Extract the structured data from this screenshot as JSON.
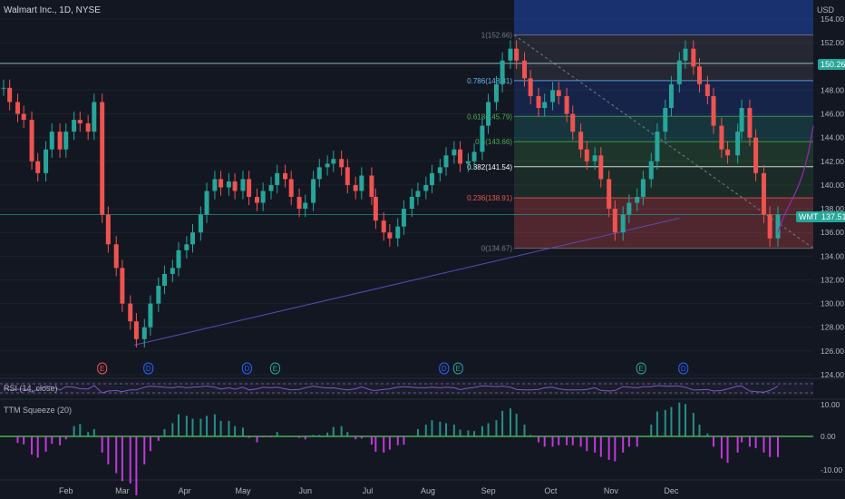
{
  "header": {
    "title": "Walmart Inc., 1D, NYSE",
    "currency": "USD"
  },
  "price_badges": {
    "level_value": "150.26",
    "symbol": "WMT",
    "last_value": "137.51"
  },
  "colors": {
    "bg": "#131722",
    "up": "#26a69a",
    "down": "#ef5350",
    "grid": "#1e222d",
    "accent_blue": "#2962ff",
    "rsi": "#7e57c2"
  },
  "fib": {
    "levels": [
      {
        "ratio_label": "1",
        "value": 152.66,
        "label": "1(152.66)",
        "color": "#787b86"
      },
      {
        "ratio_label": "0.786",
        "value": 148.81,
        "label": "0.786(148.81)",
        "color": "#64b5f6"
      },
      {
        "ratio_label": "0.618",
        "value": 145.79,
        "label": "0.618(145.79)",
        "color": "#4caf50"
      },
      {
        "ratio_label": "0.5",
        "value": 143.66,
        "label": "0.5(143.66)",
        "color": "#4caf50"
      },
      {
        "ratio_label": "0.382",
        "value": 141.54,
        "label": "0.382(141.54)",
        "color": "#ffffff"
      },
      {
        "ratio_label": "0.236",
        "value": 138.91,
        "label": "0.236(138.91)",
        "color": "#ef5350"
      },
      {
        "ratio_label": "0",
        "value": 134.67,
        "label": "0(134.67)",
        "color": "#787b86"
      }
    ]
  },
  "events": [
    {
      "type": "earnings",
      "label": "E",
      "color": "#ef5350",
      "date": "2023-02-21"
    },
    {
      "type": "dividend",
      "label": "D",
      "color": "#2962ff",
      "date": "2023-03-16"
    },
    {
      "type": "dividend",
      "label": "D",
      "color": "#2962ff",
      "date": "2023-05-04"
    },
    {
      "type": "earnings",
      "label": "E",
      "color": "#26a69a",
      "date": "2023-05-18"
    },
    {
      "type": "dividend",
      "label": "D",
      "color": "#2962ff",
      "date": "2023-08-10"
    },
    {
      "type": "earnings",
      "label": "E",
      "color": "#26a69a",
      "date": "2023-08-17"
    },
    {
      "type": "earnings",
      "label": "E",
      "color": "#26a69a",
      "date": "2023-11-16"
    },
    {
      "type": "dividend",
      "label": "D",
      "color": "#2962ff",
      "date": "2023-12-07"
    }
  ],
  "panels": {
    "rsi_label": "RSI (14, close)",
    "ttm_label": "TTM Squeeze (20)",
    "ttm_ticks": [
      "10.00",
      "0.00",
      "-10.00"
    ]
  },
  "chart_data": {
    "type": "candlestick",
    "title": "Walmart Inc., 1D, NYSE",
    "ylabel": "USD",
    "ylim": [
      124,
      156
    ],
    "y_ticks": [
      "154.00",
      "152.00",
      "150.00",
      "148.00",
      "146.00",
      "144.00",
      "142.00",
      "140.00",
      "138.00",
      "136.00",
      "134.00",
      "132.00",
      "130.00",
      "128.00",
      "126.00",
      "124.00"
    ],
    "x_ticks": [
      "Feb",
      "Mar",
      "Apr",
      "May",
      "Jun",
      "Jul",
      "Aug",
      "Sep",
      "Oct",
      "Nov",
      "Dec"
    ],
    "horizontal_lines": [
      150.26,
      137.51
    ],
    "trendline": {
      "from": [
        "2023-03-09",
        126.5
      ],
      "to": [
        "2023-12-05",
        137.2
      ]
    },
    "series": [
      {
        "name": "WMT",
        "points": [
          [
            "2023-01-03",
            148.2
          ],
          [
            "2023-01-06",
            147.0
          ],
          [
            "2023-01-10",
            146.0
          ],
          [
            "2023-01-13",
            145.5
          ],
          [
            "2023-01-17",
            142.0
          ],
          [
            "2023-01-20",
            141.0
          ],
          [
            "2023-01-24",
            143.0
          ],
          [
            "2023-01-27",
            144.5
          ],
          [
            "2023-01-31",
            143.0
          ],
          [
            "2023-02-03",
            144.5
          ],
          [
            "2023-02-07",
            145.5
          ],
          [
            "2023-02-10",
            145.2
          ],
          [
            "2023-02-14",
            144.5
          ],
          [
            "2023-02-17",
            147.0
          ],
          [
            "2023-02-21",
            137.5
          ],
          [
            "2023-02-24",
            135.0
          ],
          [
            "2023-02-28",
            133.0
          ],
          [
            "2023-03-03",
            130.0
          ],
          [
            "2023-03-07",
            128.5
          ],
          [
            "2023-03-10",
            127.0
          ],
          [
            "2023-03-14",
            128.0
          ],
          [
            "2023-03-17",
            130.0
          ],
          [
            "2023-03-21",
            131.5
          ],
          [
            "2023-03-24",
            132.5
          ],
          [
            "2023-03-28",
            133.0
          ],
          [
            "2023-03-31",
            134.5
          ],
          [
            "2023-04-04",
            135.0
          ],
          [
            "2023-04-07",
            136.0
          ],
          [
            "2023-04-11",
            137.5
          ],
          [
            "2023-04-14",
            139.5
          ],
          [
            "2023-04-18",
            140.5
          ],
          [
            "2023-04-21",
            139.8
          ],
          [
            "2023-04-25",
            140.3
          ],
          [
            "2023-04-28",
            139.5
          ],
          [
            "2023-05-02",
            140.5
          ],
          [
            "2023-05-05",
            139.0
          ],
          [
            "2023-05-09",
            138.5
          ],
          [
            "2023-05-12",
            139.5
          ],
          [
            "2023-05-16",
            140.0
          ],
          [
            "2023-05-19",
            141.0
          ],
          [
            "2023-05-23",
            140.5
          ],
          [
            "2023-05-26",
            139.0
          ],
          [
            "2023-05-30",
            138.0
          ],
          [
            "2023-06-02",
            138.5
          ],
          [
            "2023-06-06",
            140.5
          ],
          [
            "2023-06-09",
            141.5
          ],
          [
            "2023-06-13",
            141.8
          ],
          [
            "2023-06-16",
            142.2
          ],
          [
            "2023-06-20",
            141.5
          ],
          [
            "2023-06-23",
            140.0
          ],
          [
            "2023-06-27",
            139.5
          ],
          [
            "2023-06-30",
            140.8
          ],
          [
            "2023-07-05",
            139.0
          ],
          [
            "2023-07-07",
            137.0
          ],
          [
            "2023-07-11",
            136.0
          ],
          [
            "2023-07-14",
            135.5
          ],
          [
            "2023-07-18",
            136.5
          ],
          [
            "2023-07-21",
            138.0
          ],
          [
            "2023-07-25",
            139.0
          ],
          [
            "2023-07-28",
            139.5
          ],
          [
            "2023-08-01",
            140.0
          ],
          [
            "2023-08-04",
            141.0
          ],
          [
            "2023-08-08",
            141.5
          ],
          [
            "2023-08-11",
            142.5
          ],
          [
            "2023-08-15",
            143.0
          ],
          [
            "2023-08-18",
            141.8
          ],
          [
            "2023-08-22",
            142.0
          ],
          [
            "2023-08-25",
            142.8
          ],
          [
            "2023-08-29",
            145.0
          ],
          [
            "2023-09-01",
            147.0
          ],
          [
            "2023-09-05",
            148.5
          ],
          [
            "2023-09-08",
            150.5
          ],
          [
            "2023-09-12",
            151.5
          ],
          [
            "2023-09-15",
            150.5
          ],
          [
            "2023-09-19",
            149.0
          ],
          [
            "2023-09-22",
            147.5
          ],
          [
            "2023-09-26",
            146.5
          ],
          [
            "2023-09-29",
            147.0
          ],
          [
            "2023-10-03",
            148.0
          ],
          [
            "2023-10-06",
            147.5
          ],
          [
            "2023-10-10",
            146.0
          ],
          [
            "2023-10-13",
            144.5
          ],
          [
            "2023-10-17",
            143.0
          ],
          [
            "2023-10-20",
            142.0
          ],
          [
            "2023-10-24",
            142.5
          ],
          [
            "2023-10-27",
            140.5
          ],
          [
            "2023-10-31",
            138.0
          ],
          [
            "2023-11-03",
            136.0
          ],
          [
            "2023-11-07",
            137.5
          ],
          [
            "2023-11-10",
            138.5
          ],
          [
            "2023-11-14",
            139.0
          ],
          [
            "2023-11-17",
            140.5
          ],
          [
            "2023-11-21",
            142.0
          ],
          [
            "2023-11-24",
            144.5
          ],
          [
            "2023-11-28",
            146.5
          ],
          [
            "2023-12-01",
            148.5
          ],
          [
            "2023-12-05",
            150.5
          ],
          [
            "2023-12-08",
            151.5
          ],
          [
            "2023-12-12",
            150.0
          ],
          [
            "2023-12-15",
            148.5
          ],
          [
            "2023-12-19",
            147.5
          ],
          [
            "2023-12-22",
            145.0
          ],
          [
            "2023-12-26",
            143.0
          ],
          [
            "2023-12-29",
            142.5
          ],
          [
            "2024-01-03",
            144.5
          ],
          [
            "2024-01-05",
            146.5
          ],
          [
            "2024-01-09",
            144.0
          ],
          [
            "2024-01-12",
            141.0
          ],
          [
            "2024-01-16",
            137.5
          ],
          [
            "2024-01-19",
            135.5
          ],
          [
            "2024-01-23",
            137.5
          ]
        ]
      }
    ]
  }
}
